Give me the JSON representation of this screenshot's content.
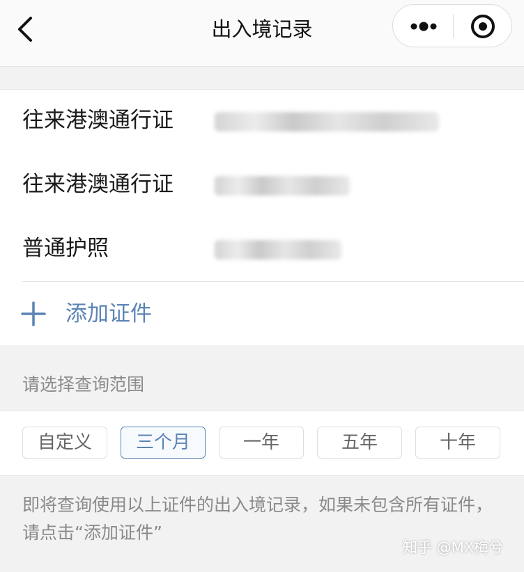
{
  "navbar": {
    "title": "出入境记录",
    "back_icon": "chevron-left-icon",
    "more_icon": "more-dots-icon",
    "close_icon": "target-circle-icon"
  },
  "documents": [
    {
      "label": "往来港澳通行证",
      "number_state": "blurred"
    },
    {
      "label": "往来港澳通行证",
      "number_state": "blurred"
    },
    {
      "label": "普通护照",
      "number_state": "blurred"
    }
  ],
  "add_document": {
    "icon": "plus-icon",
    "label": "添加证件"
  },
  "range": {
    "hint": "请选择查询范围",
    "options": [
      "自定义",
      "三个月",
      "一年",
      "五年",
      "十年"
    ],
    "selected": "三个月"
  },
  "note": "即将查询使用以上证件的出入境记录，如果未包含所有证件，请点击“添加证件”",
  "watermark": "知乎 @MX梅兮",
  "colors": {
    "accent": "#5b84b6",
    "background": "#f2f2f2",
    "card": "#ffffff"
  }
}
